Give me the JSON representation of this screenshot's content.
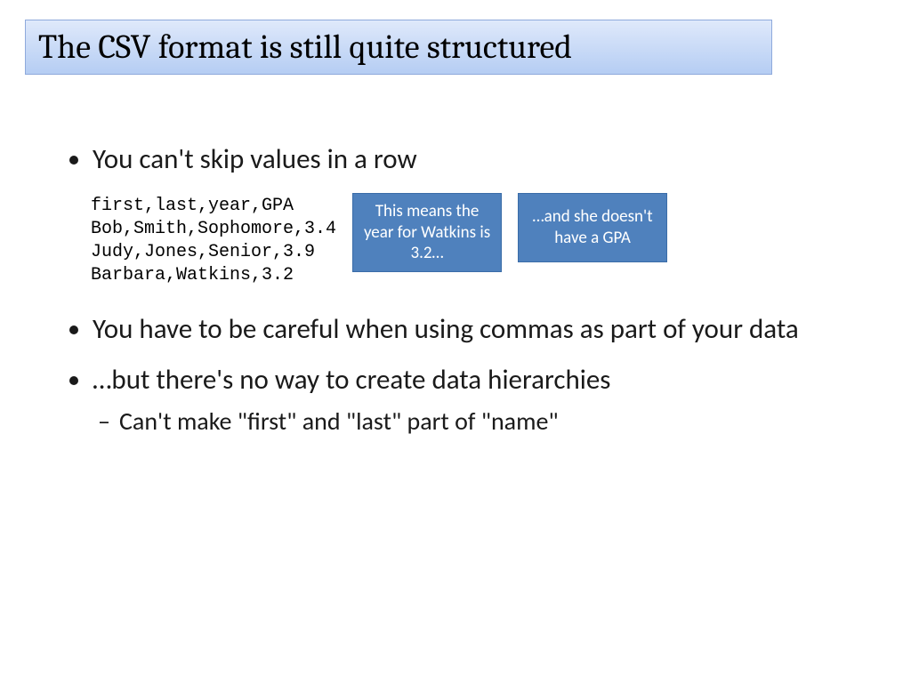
{
  "title": "The CSV format is still quite structured",
  "bullets": {
    "b1": "You can't skip values in a row",
    "b2": "You have to be careful when using commas as part of your data",
    "b3": "…but there's no way to create data hierarchies",
    "b3_sub1": "Can't make \"first\" and \"last\" part of \"name\""
  },
  "code": "first,last,year,GPA\nBob,Smith,Sophomore,3.4\nJudy,Jones,Senior,3.9\nBarbara,Watkins,3.2",
  "callouts": {
    "c1": "This means the year for Watkins is 3.2…",
    "c2": "…and she doesn't have a GPA"
  }
}
